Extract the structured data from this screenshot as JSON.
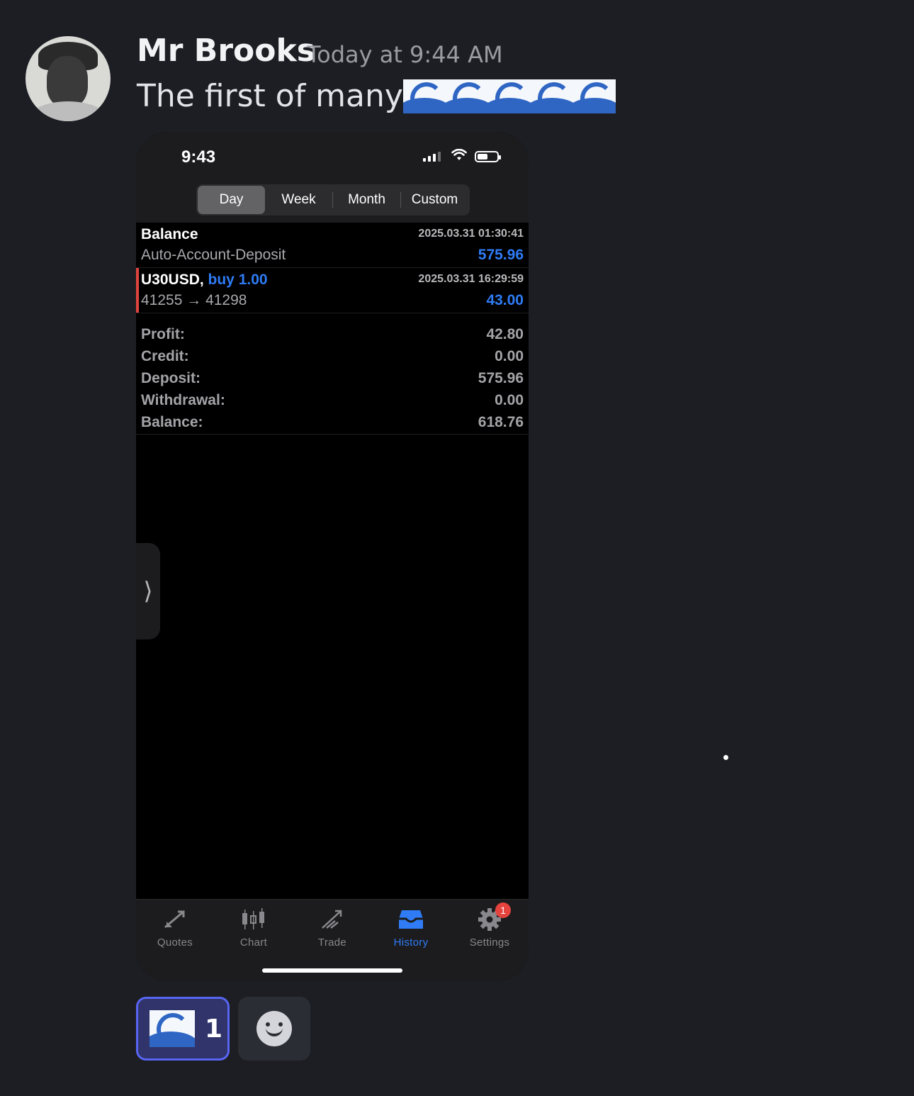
{
  "message": {
    "author": "Mr Brooks",
    "timestamp": "Today at 9:44 AM",
    "text": "The first of many",
    "emoji_name": "ocean-wave-emoji",
    "emoji_count_inline": 5
  },
  "phone": {
    "status_time": "9:43",
    "tabs": [
      "Day",
      "Week",
      "Month",
      "Custom"
    ],
    "active_tab": "Day",
    "deals": [
      {
        "title": "Balance",
        "title_suffix": "",
        "subtitle": "Auto-Account-Deposit",
        "datetime": "2025.03.31 01:30:41",
        "amount": "575.96"
      },
      {
        "title": "U30USD, ",
        "title_suffix": "buy 1.00",
        "subtitle": "41255 → 41298",
        "datetime": "2025.03.31 16:29:59",
        "amount": "43.00"
      }
    ],
    "summary": {
      "profit_label": "Profit:",
      "profit": "42.80",
      "credit_label": "Credit:",
      "credit": "0.00",
      "deposit_label": "Deposit:",
      "deposit": "575.96",
      "withdrawal_label": "Withdrawal:",
      "withdrawal": "0.00",
      "balance_label": "Balance:",
      "balance": "618.76"
    },
    "handle_glyph": "⟩",
    "tabbar": [
      {
        "label": "Quotes",
        "icon": "quotes-icon"
      },
      {
        "label": "Chart",
        "icon": "chart-icon"
      },
      {
        "label": "Trade",
        "icon": "trade-icon"
      },
      {
        "label": "History",
        "icon": "history-icon"
      },
      {
        "label": "Settings",
        "icon": "settings-icon"
      }
    ],
    "active_tabbar": "History",
    "settings_badge": "1",
    "colors": {
      "accent": "#2f7cf6",
      "loss_marker": "#e0443e",
      "badge": "#e5433d"
    }
  },
  "reactions": {
    "wave_count": "1",
    "add_reaction_icon": "add-reaction-smile-icon"
  }
}
